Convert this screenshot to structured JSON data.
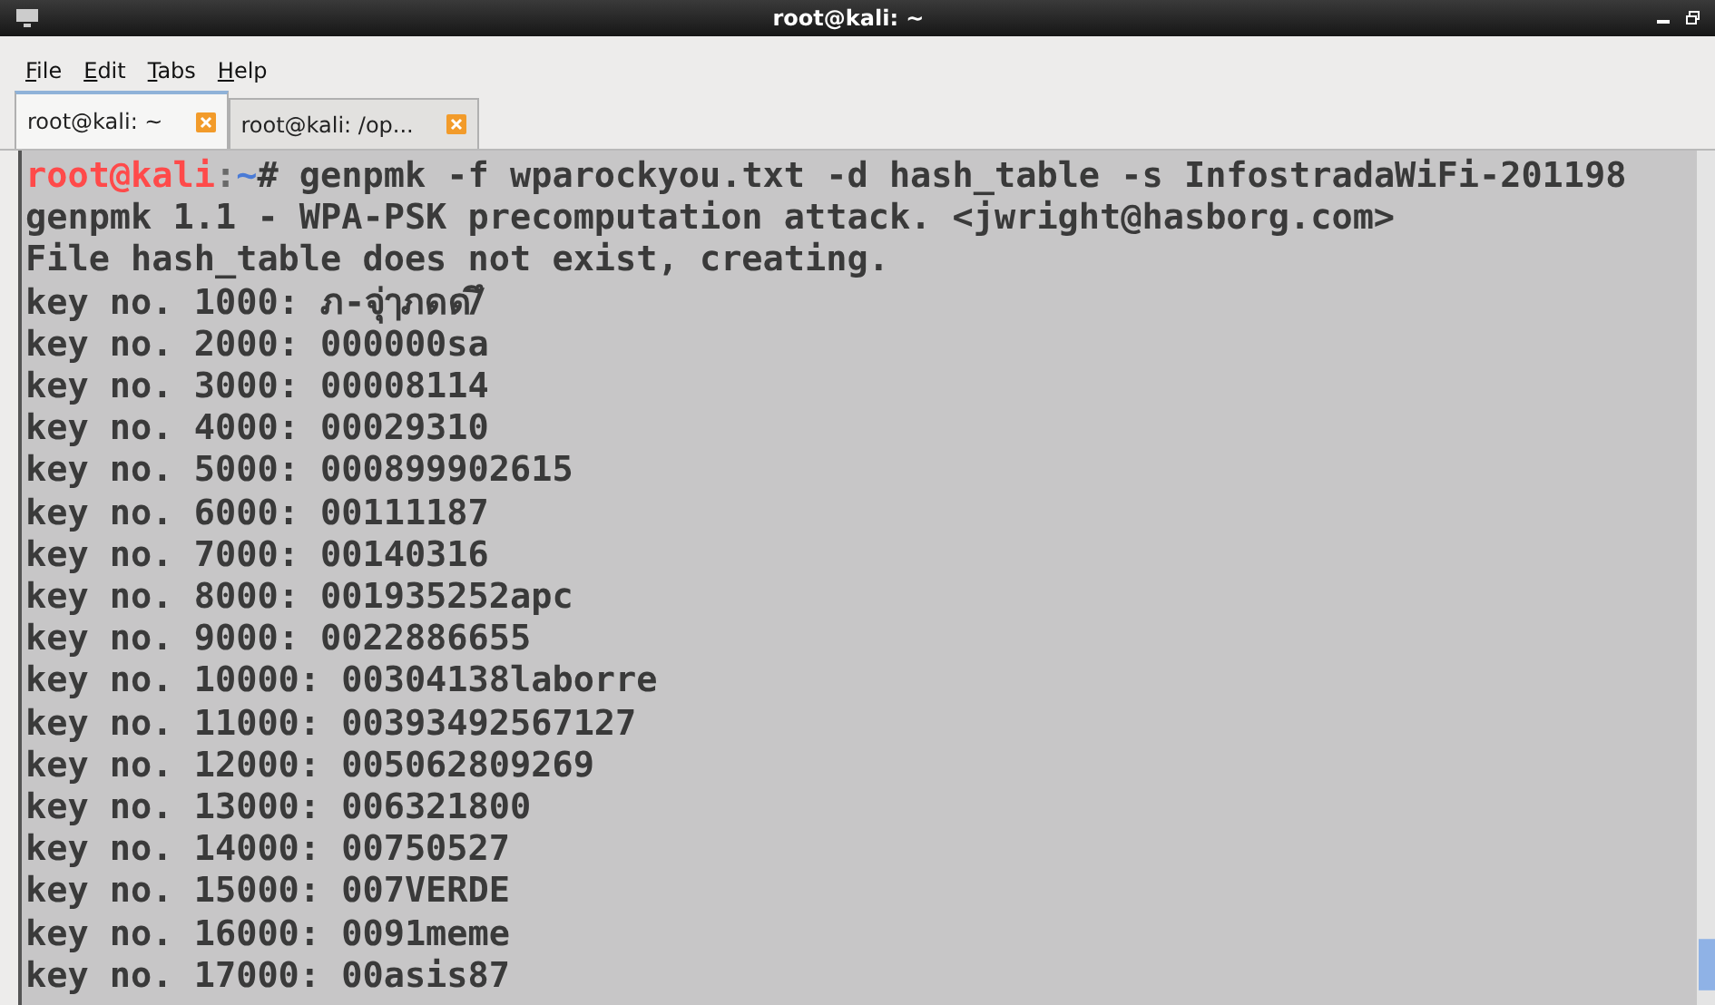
{
  "window": {
    "title": "root@kali: ~"
  },
  "menu": [
    {
      "mnemonic": "F",
      "rest": "ile"
    },
    {
      "mnemonic": "E",
      "rest": "dit"
    },
    {
      "mnemonic": "T",
      "rest": "abs"
    },
    {
      "mnemonic": "H",
      "rest": "elp"
    }
  ],
  "tabs": [
    {
      "label": "root@kali: ~",
      "selected": true
    },
    {
      "label": "root@kali: /op...",
      "selected": false
    }
  ],
  "terminal": {
    "prompt": {
      "user": "root@kali",
      "separator": ":",
      "path": "~",
      "symbol": "#",
      "command": " genpmk -f wparockyou.txt -d hash_table -s InfostradaWiFi-201198"
    },
    "lines": [
      "genpmk 1.1 - WPA-PSK precomputation attack. <jwright@hasborg.com>",
      "File hash_table does not exist, creating.",
      "key no. 1000: ภ-จุ่ๅภดด/ึ",
      "key no. 2000: 000000sa",
      "key no. 3000: 00008114",
      "key no. 4000: 00029310",
      "key no. 5000: 000899902615",
      "key no. 6000: 00111187",
      "key no. 7000: 00140316",
      "key no. 8000: 001935252apc",
      "key no. 9000: 0022886655",
      "key no. 10000: 00304138laborre",
      "key no. 11000: 00393492567127",
      "key no. 12000: 005062809269",
      "key no. 13000: 006321800",
      "key no. 14000: 00750527",
      "key no. 15000: 007VERDE",
      "key no. 16000: 0091meme",
      "key no. 17000: 00asis87"
    ]
  }
}
